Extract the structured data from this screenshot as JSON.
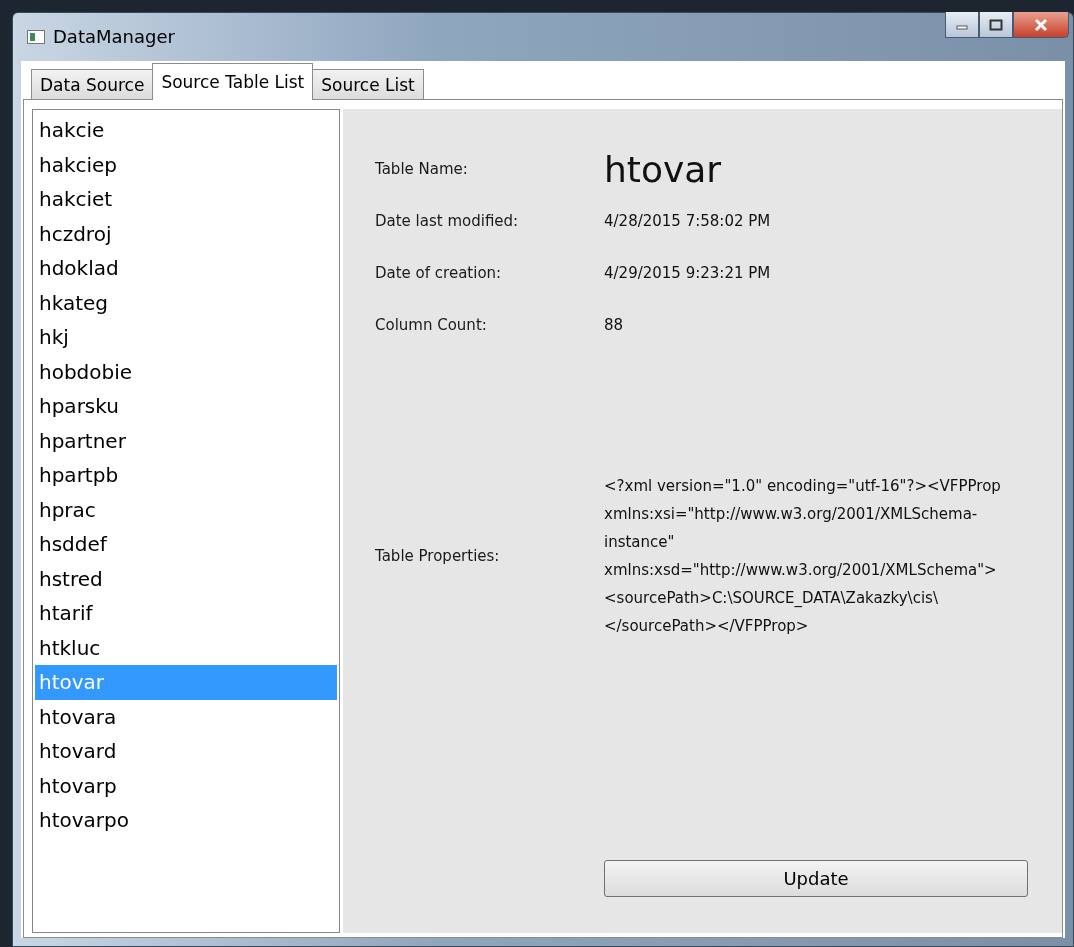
{
  "window": {
    "title": "DataManager"
  },
  "tabs": [
    {
      "label": "Data Source",
      "selected": false
    },
    {
      "label": "Source Table List",
      "selected": true
    },
    {
      "label": "Source List",
      "selected": false
    }
  ],
  "tables": [
    {
      "name": "hakcie",
      "selected": false
    },
    {
      "name": "hakciep",
      "selected": false
    },
    {
      "name": "hakciet",
      "selected": false
    },
    {
      "name": "hczdroj",
      "selected": false
    },
    {
      "name": "hdoklad",
      "selected": false
    },
    {
      "name": "hkateg",
      "selected": false
    },
    {
      "name": "hkj",
      "selected": false
    },
    {
      "name": "hobdobie",
      "selected": false
    },
    {
      "name": "hparsku",
      "selected": false
    },
    {
      "name": "hpartner",
      "selected": false
    },
    {
      "name": "hpartpb",
      "selected": false
    },
    {
      "name": "hprac",
      "selected": false
    },
    {
      "name": "hsddef",
      "selected": false
    },
    {
      "name": "hstred",
      "selected": false
    },
    {
      "name": "htarif",
      "selected": false
    },
    {
      "name": "htkluc",
      "selected": false
    },
    {
      "name": "htovar",
      "selected": true
    },
    {
      "name": "htovara",
      "selected": false
    },
    {
      "name": "htovard",
      "selected": false
    },
    {
      "name": "htovarp",
      "selected": false
    },
    {
      "name": "htovarpo",
      "selected": false
    }
  ],
  "details": [
    {
      "kind": "title",
      "label": "Table Name:",
      "value": "htovar"
    },
    {
      "kind": "plain",
      "label": "Date last modified:",
      "value": "4/28/2015 7:58:02 PM"
    },
    {
      "kind": "plain",
      "label": "Date of creation:",
      "value": "4/29/2015 9:23:21 PM"
    },
    {
      "kind": "plain",
      "label": "Column Count:",
      "value": "88"
    },
    {
      "kind": "block",
      "label": "Table Properties:",
      "value": "<?xml version=\"1.0\" encoding=\"utf-16\"?><VFPProp xmlns:xsi=\"http://www.w3.org/2001/XMLSchema-instance\" xmlns:xsd=\"http://www.w3.org/2001/XMLSchema\"><sourcePath>C:\\SOURCE_DATA\\Zakazky\\cis\\</sourcePath></VFPProp>"
    }
  ],
  "update_button": {
    "label": "Update"
  }
}
